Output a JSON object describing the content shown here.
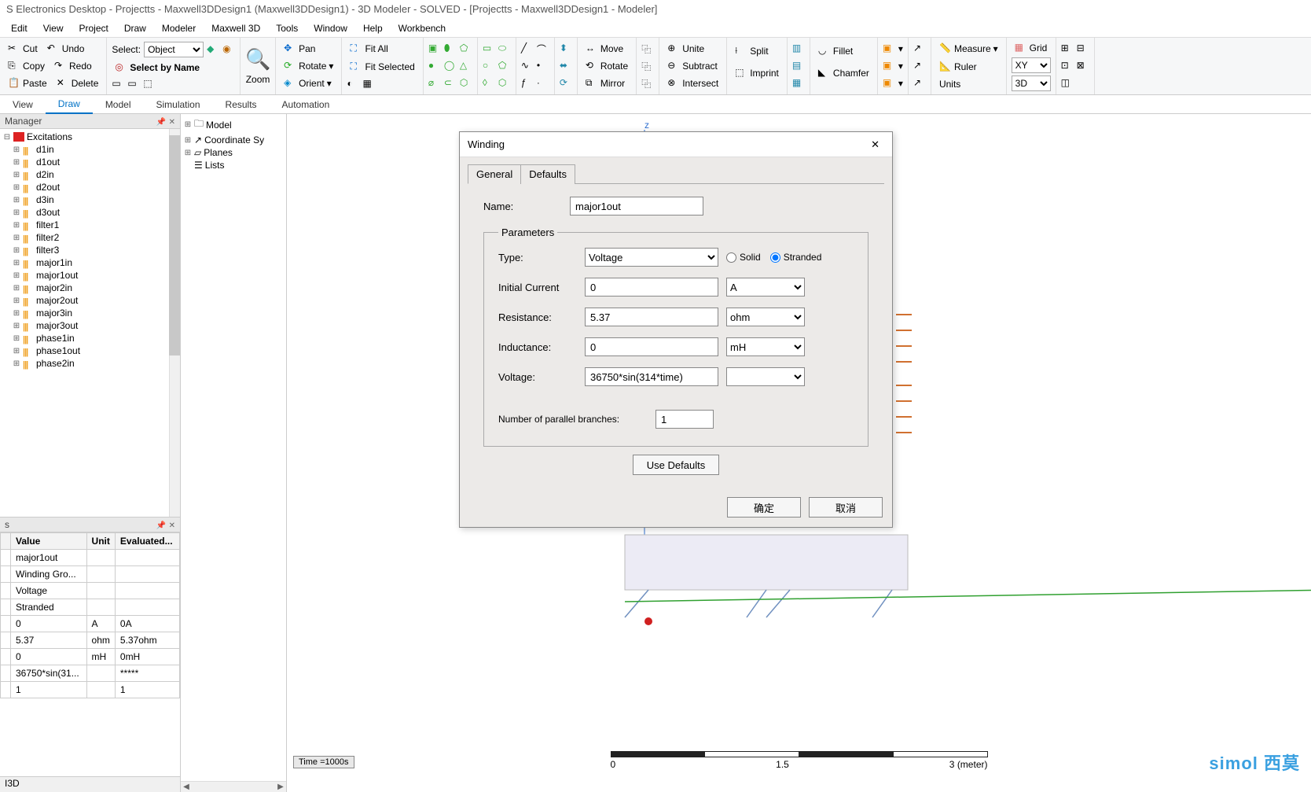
{
  "title": "S Electronics Desktop - Projectts - Maxwell3DDesign1 (Maxwell3DDesign1) - 3D Modeler - SOLVED - [Projectts - Maxwell3DDesign1 - Modeler]",
  "menu": [
    "Edit",
    "View",
    "Project",
    "Draw",
    "Modeler",
    "Maxwell 3D",
    "Tools",
    "Window",
    "Help",
    "Workbench"
  ],
  "ribbon": {
    "clipboard": {
      "cut": "Cut",
      "undo": "Undo",
      "copy": "Copy",
      "redo": "Redo",
      "paste": "Paste",
      "delete": "Delete"
    },
    "select": {
      "label": "Select:",
      "mode": "Object",
      "byname": "Select by Name"
    },
    "zoom": {
      "zoom": "Zoom"
    },
    "view": {
      "pan": "Pan",
      "rotate": "Rotate",
      "orient": "Orient",
      "fitall": "Fit All",
      "fitsel": "Fit Selected"
    },
    "arrange": {
      "move": "Move",
      "rotate": "Rotate",
      "mirror": "Mirror"
    },
    "bool": {
      "unite": "Unite",
      "subtract": "Subtract",
      "intersect": "Intersect",
      "split": "Split",
      "imprint": "Imprint"
    },
    "edge": {
      "fillet": "Fillet",
      "chamfer": "Chamfer"
    },
    "meas": {
      "measure": "Measure",
      "ruler": "Ruler",
      "units": "Units",
      "grid": "Grid",
      "plane": "XY",
      "space": "3D"
    }
  },
  "tabs2": [
    "View",
    "Draw",
    "Model",
    "Simulation",
    "Results",
    "Automation"
  ],
  "active_tab2": "Draw",
  "pm": {
    "title": "Manager",
    "root": "Excitations",
    "items": [
      "d1in",
      "d1out",
      "d2in",
      "d2out",
      "d3in",
      "d3out",
      "filter1",
      "filter2",
      "filter3",
      "major1in",
      "major1out",
      "major2in",
      "major2out",
      "major3in",
      "major3out",
      "phase1in",
      "phase1out",
      "phase2in"
    ]
  },
  "props": {
    "title": "s",
    "header": [
      "",
      "Value",
      "Unit",
      "Evaluated..."
    ],
    "rows": [
      [
        "",
        "major1out",
        "",
        ""
      ],
      [
        "",
        "Winding Gro...",
        "",
        ""
      ],
      [
        "",
        "Voltage",
        "",
        ""
      ],
      [
        "",
        "Stranded",
        "",
        ""
      ],
      [
        "",
        "0",
        "A",
        "0A"
      ],
      [
        "",
        "5.37",
        "ohm",
        "5.37ohm"
      ],
      [
        "",
        "0",
        "mH",
        "0mH"
      ],
      [
        "",
        "36750*sin(31...",
        "",
        "*****"
      ],
      [
        "",
        "1",
        "",
        "1"
      ]
    ]
  },
  "modeltree": [
    "Model",
    "Coordinate Sy",
    "Planes",
    "Lists"
  ],
  "canvas": {
    "time": "Time   =1000s",
    "scale": {
      "a": "0",
      "b": "1.5",
      "c": "3",
      "unit": "(meter)"
    },
    "watermark": "simol 西莫",
    "axis_z": "z"
  },
  "bottomtab": "I3D",
  "dialog": {
    "title": "Winding",
    "tabs": [
      "General",
      "Defaults"
    ],
    "active_tab": "General",
    "name_label": "Name:",
    "name_value": "major1out",
    "params_legend": "Parameters",
    "type_label": "Type:",
    "type_value": "Voltage",
    "solid": "Solid",
    "stranded": "Stranded",
    "ic_label": "Initial Current",
    "ic_value": "0",
    "ic_unit": "A",
    "r_label": "Resistance:",
    "r_value": "5.37",
    "r_unit": "ohm",
    "l_label": "Inductance:",
    "l_value": "0",
    "l_unit": "mH",
    "v_label": "Voltage:",
    "v_value": "36750*sin(314*time)",
    "v_unit": "",
    "branches_label": "Number of parallel branches:",
    "branches_value": "1",
    "use_defaults": "Use Defaults",
    "ok": "确定",
    "cancel": "取消"
  }
}
